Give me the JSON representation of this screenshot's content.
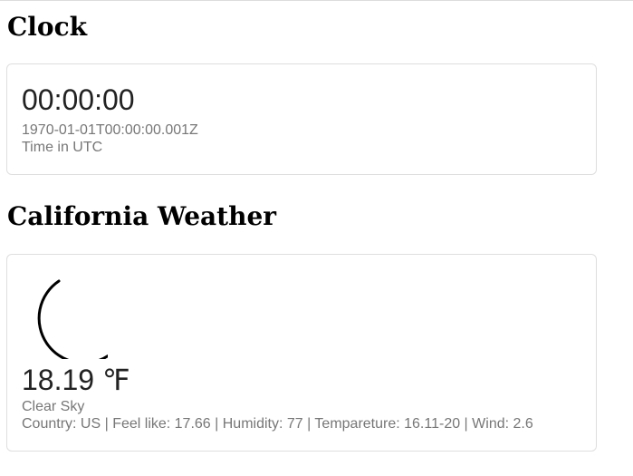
{
  "clock": {
    "heading": "Clock",
    "time": "00:00:00",
    "iso": "1970-01-01T00:00:00.001Z",
    "caption": "Time in UTC"
  },
  "weather": {
    "heading": "California Weather",
    "icon": "moon-icon",
    "temperature": "18.19 ℉",
    "description": "Clear Sky",
    "details": "Country: US | Feel like: 17.66 | Humidity: 77 | Tempareture: 16.11-20 | Wind: 2.6"
  }
}
